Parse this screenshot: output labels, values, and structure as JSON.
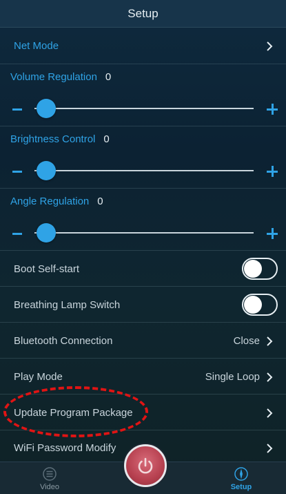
{
  "header": {
    "title": "Setup"
  },
  "net_mode": {
    "label": "Net Mode"
  },
  "sliders": [
    {
      "label": "Volume Regulation",
      "value": "0",
      "position": 0
    },
    {
      "label": "Brightness Control",
      "value": "0",
      "position": 0
    },
    {
      "label": "Angle Regulation",
      "value": "0",
      "position": 0
    }
  ],
  "toggles": [
    {
      "label": "Boot Self-start",
      "on": false
    },
    {
      "label": "Breathing Lamp Switch",
      "on": false
    }
  ],
  "bluetooth": {
    "label": "Bluetooth Connection",
    "value": "Close"
  },
  "play_mode": {
    "label": "Play Mode",
    "value": "Single Loop"
  },
  "update": {
    "label": "Update Program Package"
  },
  "wifi": {
    "label": "WiFi Password Modify"
  },
  "tabs": {
    "video": {
      "label": "Video",
      "icon": "list-icon"
    },
    "setup": {
      "label": "Setup",
      "icon": "compass-icon"
    },
    "power": {
      "icon": "power-icon"
    }
  },
  "colors": {
    "accent": "#2fa3e6",
    "annotation": "#e01414",
    "power_button": "#b6404f"
  }
}
